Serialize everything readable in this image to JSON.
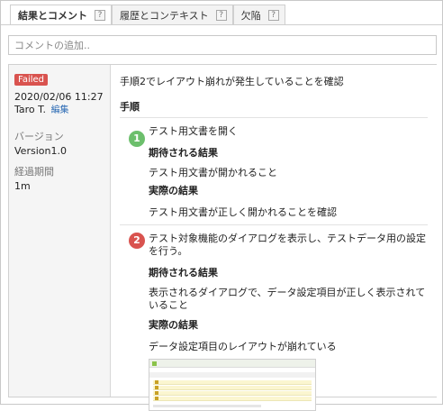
{
  "tabs": [
    {
      "label": "結果とコメント",
      "help": "?"
    },
    {
      "label": "履歴とコンテキスト",
      "help": "?"
    },
    {
      "label": "欠陥",
      "help": "?"
    }
  ],
  "comment": {
    "placeholder": "コメントの追加.."
  },
  "result": {
    "status": "Failed",
    "status_color": "#d9534f",
    "datetime": "2020/02/06 11:27",
    "user": "Taro T.",
    "edit_label": "編集",
    "version_label": "バージョン",
    "version_value": "Version1.0",
    "elapsed_label": "経過期間",
    "elapsed_value": "1m"
  },
  "detail": {
    "summary": "手順2でレイアウト崩れが発生していることを確認",
    "steps_title": "手順",
    "steps": [
      {
        "number": "1",
        "color": "#6cbf6c",
        "content": "テスト用文書を開く",
        "expected_label": "期待される結果",
        "expected": "テスト用文書が開かれること",
        "actual_label": "実際の結果",
        "actual": "テスト用文書が正しく開かれることを確認"
      },
      {
        "number": "2",
        "color": "#d9534f",
        "content": "テスト対象機能のダイアログを表示し、テストデータ用の設定を行う。",
        "expected_label": "期待される結果",
        "expected": "表示されるダイアログで、データ設定項目が正しく表示されていること",
        "actual_label": "実際の結果",
        "actual": "データ設定項目のレイアウトが崩れている"
      }
    ]
  }
}
